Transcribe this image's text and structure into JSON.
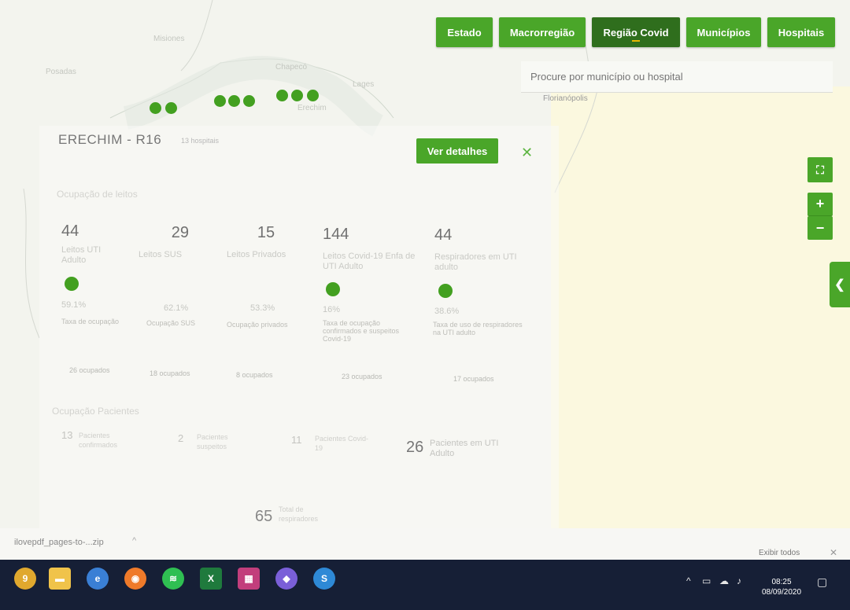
{
  "nav": {
    "buttons": [
      "Estado",
      "Macrorregião",
      "Região Covid",
      "Municípios",
      "Hospitais"
    ],
    "active_index": 2
  },
  "search": {
    "placeholder": "Procure por município ou hospital"
  },
  "map": {
    "labels": [
      "Posadas",
      "Chapecó",
      "Erechim",
      "Florianópolis",
      "Lages",
      "Misiones"
    ]
  },
  "region": {
    "title": "ERECHIM - R16",
    "subtitle": "13 hospitais",
    "details_button": "Ver detalhes",
    "close_icon": "close-icon"
  },
  "beds": {
    "section_title": "Ocupação de leitos",
    "stats": [
      {
        "value": "44",
        "label": "Leitos UTI Adulto",
        "percent": "59.1%",
        "caption": "Taxa de ocupação",
        "occupied": "26 ocupados"
      },
      {
        "value": "29",
        "label": "Leitos SUS",
        "percent": "62.1%",
        "caption": "Ocupação SUS",
        "occupied": "18 ocupados"
      },
      {
        "value": "15",
        "label": "Leitos Privados",
        "percent": "53.3%",
        "caption": "Ocupação privados",
        "occupied": "8 ocupados"
      },
      {
        "value": "144",
        "label": "Leitos Covid-19 Enfa de UTI Adulto",
        "percent": "16%",
        "caption": "Taxa de ocupação confirmados e suspeitos Covid-19",
        "occupied": "23 ocupados"
      },
      {
        "value": "44",
        "label": "Respiradores em UTI adulto",
        "percent": "38.6%",
        "caption": "Taxa de uso de respiradores na UTI adulto",
        "occupied": "17 ocupados"
      }
    ]
  },
  "patients": {
    "section_title": "Ocupação Pacientes",
    "items": [
      {
        "value": "13",
        "label": "Pacientes confirmados"
      },
      {
        "value": "2",
        "label": "Pacientes suspeitos"
      },
      {
        "value": "11",
        "label": "Pacientes Covid-19"
      },
      {
        "value": "26",
        "label": "Pacientes em UTI Adulto"
      }
    ],
    "total": {
      "value": "65",
      "label": "Total de respiradores"
    }
  },
  "controls": {
    "fullscreen_icon": "fullscreen-icon",
    "zoom_in": "+",
    "zoom_out": "−",
    "collapse_icon": "chevron-left-icon"
  },
  "download_bar": {
    "file": "ilovepdf_pages-to-...zip",
    "show_all": "Exibir todos"
  },
  "taskbar": {
    "time": "08:25",
    "date": "08/09/2020"
  },
  "colors": {
    "primary": "#4aa629",
    "active": "#2f6e1d",
    "indicator": "#e6b800",
    "taskbar": "#161f36"
  }
}
